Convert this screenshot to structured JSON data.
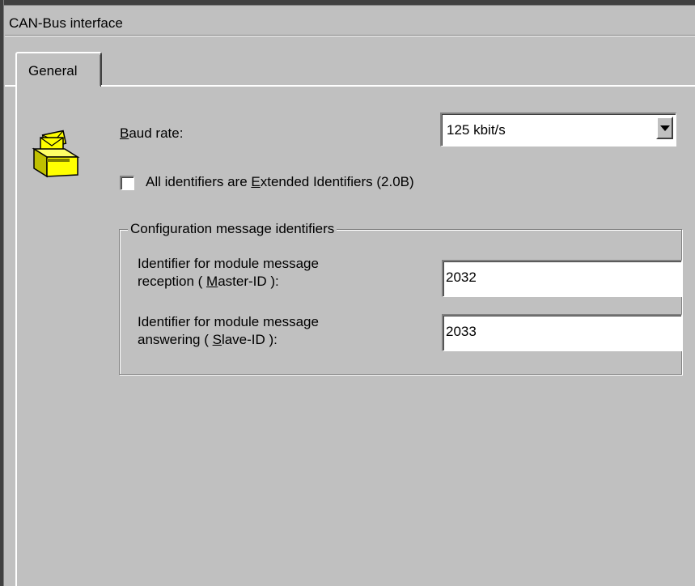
{
  "window": {
    "title": "CAN-Bus interface"
  },
  "tabs": [
    {
      "label": "General"
    }
  ],
  "icon": {
    "name": "message-tray-icon",
    "color": "#ffff00"
  },
  "baud": {
    "label_mnemonic": "B",
    "label_rest": "aud rate:",
    "selected": "125 kbit/s"
  },
  "extended": {
    "checked": false,
    "label_pre": "All identifiers are ",
    "label_mnemonic": "E",
    "label_post": "xtended Identifiers (2.0B)"
  },
  "config_group": {
    "title": "Configuration message identifiers",
    "master": {
      "line1": "Identifier for module message",
      "line2_pre": "reception ( ",
      "line2_mnemonic": "M",
      "line2_post": "aster-ID ):",
      "value": "2032"
    },
    "slave": {
      "line1": "Identifier for module message",
      "line2_pre": "answering ( ",
      "line2_mnemonic": "S",
      "line2_post": "lave-ID ):",
      "value": "2033"
    }
  }
}
